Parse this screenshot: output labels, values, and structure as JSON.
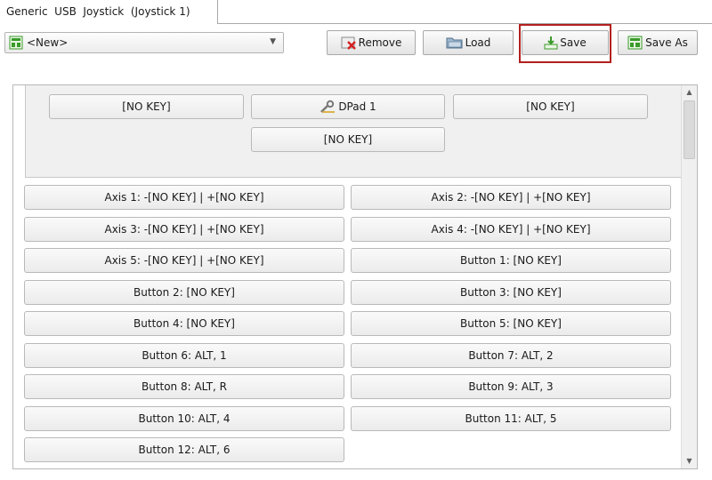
{
  "tab": {
    "label": "Generic  USB  Joystick  (Joystick 1)"
  },
  "toolbar": {
    "profile_value": "<New>",
    "remove_label": "Remove",
    "load_label": "Load",
    "save_label": "Save",
    "save_as_label": "Save As"
  },
  "dpad": {
    "top_left": "[NO KEY]",
    "center": "DPad 1",
    "top_right": "[NO KEY]",
    "bottom": "[NO KEY]"
  },
  "bindings": [
    "Axis 1: -[NO KEY] | +[NO KEY]",
    "Axis 2: -[NO KEY] | +[NO KEY]",
    "Axis 3: -[NO KEY] | +[NO KEY]",
    "Axis 4: -[NO KEY] | +[NO KEY]",
    "Axis 5: -[NO KEY] | +[NO KEY]",
    "Button 1: [NO KEY]",
    "Button 2: [NO KEY]",
    "Button 3: [NO KEY]",
    "Button 4: [NO KEY]",
    "Button 5: [NO KEY]",
    "Button 6: ALT, 1",
    "Button 7: ALT, 2",
    "Button 8: ALT, R",
    "Button 9: ALT, 3",
    "Button 10: ALT, 4",
    "Button 11: ALT, 5",
    "Button 12: ALT, 6"
  ],
  "colors": {
    "highlight": "#b3201d",
    "icon_green": "#3a9a2a",
    "remove_red": "#d42020"
  },
  "icons": {
    "scroll_up": "▲",
    "scroll_down": "▼",
    "dropdown": "▼"
  }
}
